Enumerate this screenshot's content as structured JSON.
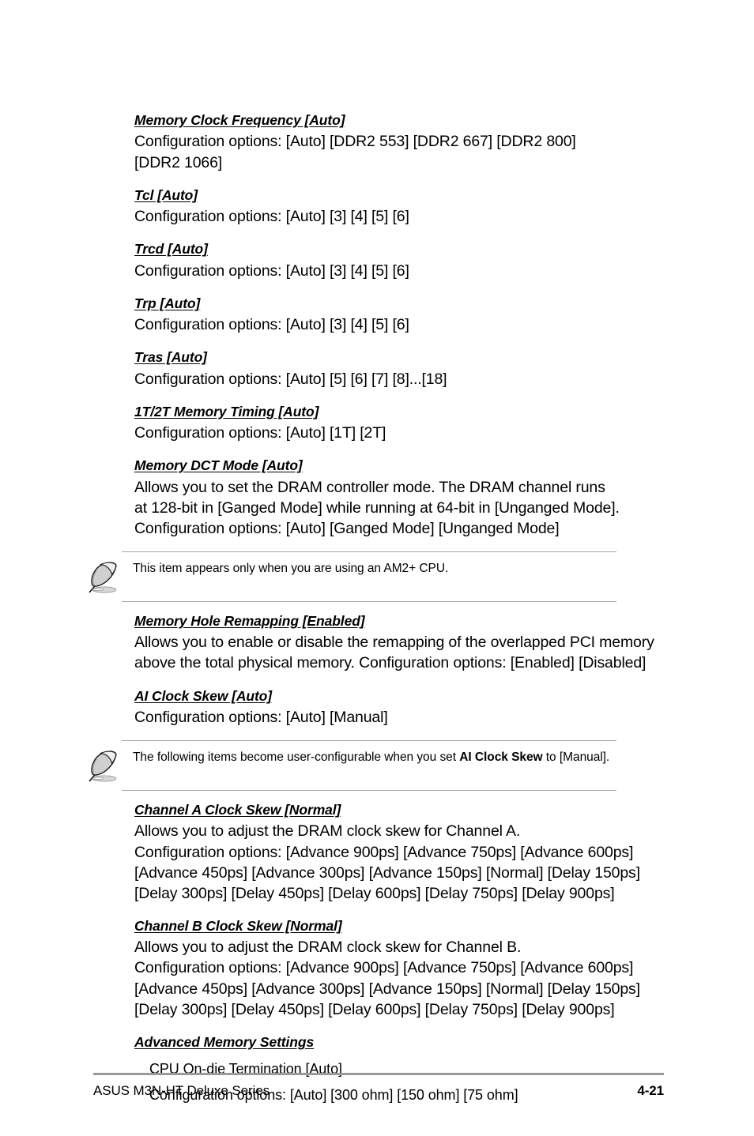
{
  "page": {
    "number": "4-21",
    "footer_left": "ASUS M3N-HT Deluxe Series"
  },
  "sections": [
    {
      "heading": "Memory Clock Frequency [Auto]",
      "lines": [
        "Configuration options: [Auto] [DDR2 553] [DDR2 667] [DDR2 800]",
        "[DDR2 1066]"
      ]
    },
    {
      "heading": "Tcl [Auto]",
      "lines": [
        "Configuration options: [Auto] [3] [4] [5] [6]"
      ]
    },
    {
      "heading": "Trcd [Auto]",
      "lines": [
        "Configuration options: [Auto] [3] [4] [5] [6]"
      ]
    },
    {
      "heading": "Trp [Auto]",
      "lines": [
        "Configuration options: [Auto] [3] [4] [5] [6]"
      ]
    },
    {
      "heading": "Tras [Auto]",
      "lines": [
        "Configuration options: [Auto] [5] [6] [7] [8]...[18]"
      ]
    },
    {
      "heading": "1T/2T Memory Timing [Auto]",
      "lines": [
        "Configuration options: [Auto] [1T] [2T]"
      ]
    },
    {
      "heading": "Memory DCT Mode [Auto]",
      "lines": [
        "Allows you to set the DRAM controller mode. The DRAM channel runs",
        "at 128-bit in [Ganged Mode] while running at 64-bit in [Unganged Mode].",
        "Configuration options: [Auto] [Ganged Mode] [Unganged Mode]"
      ]
    },
    {
      "heading": "Memory Hole Remapping [Enabled]",
      "lines": [
        "Allows you to enable or disable the remapping of the overlapped PCI memory",
        "above the total physical memory. Configuration options: [Enabled] [Disabled]"
      ]
    },
    {
      "heading": "AI Clock Skew [Auto]",
      "lines": [
        "Configuration options: [Auto] [Manual]"
      ]
    },
    {
      "heading": "Channel A Clock Skew [Normal]",
      "lines": [
        "Allows you to adjust the DRAM clock skew for Channel A.",
        "Configuration options: [Advance 900ps] [Advance 750ps] [Advance 600ps]",
        "[Advance 450ps] [Advance 300ps] [Advance 150ps] [Normal] [Delay 150ps]",
        "[Delay 300ps] [Delay 450ps] [Delay 600ps] [Delay 750ps] [Delay 900ps]"
      ]
    },
    {
      "heading": "Channel B Clock Skew [Normal]",
      "lines": [
        "Allows you to adjust the DRAM clock skew for Channel B.",
        "Configuration options: [Advance 900ps] [Advance 750ps] [Advance 600ps]",
        "[Advance 450ps] [Advance 300ps] [Advance 150ps] [Normal] [Delay 150ps]",
        "[Delay 300ps] [Delay 450ps] [Delay 600ps] [Delay 750ps] [Delay 900ps]"
      ]
    },
    {
      "heading": "Advanced Memory Settings",
      "sub_lines": [
        "CPU On-die Termination [Auto]",
        "Configuration options: [Auto] [300 ohm] [150 ohm] [75 ohm]"
      ]
    }
  ],
  "notes": [
    {
      "icon": "quill-note-icon",
      "text_prefix": "This item appears only when you are using an AM2+ CPU.",
      "text_bold": "",
      "text_suffix": ""
    },
    {
      "icon": "quill-note-icon",
      "text_prefix": "The following items become user-configurable when you set ",
      "text_bold": "AI Clock Skew",
      "text_suffix": " to [Manual]."
    }
  ],
  "colors": {
    "rule_gray": "#a7a7a7",
    "footer_rule_gray": "#9a9a9a",
    "text": "#000000"
  }
}
